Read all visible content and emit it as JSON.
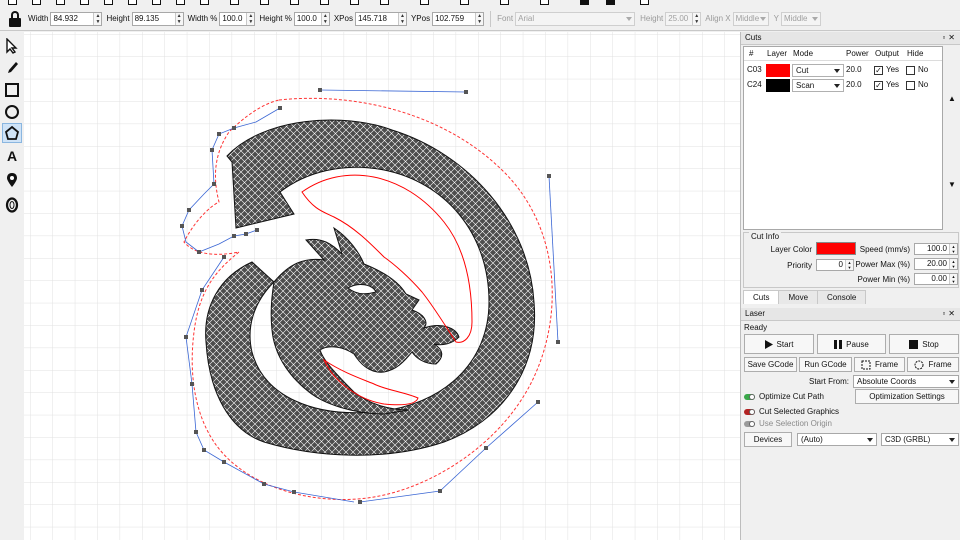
{
  "props": {
    "width_label": "Width",
    "width_value": "84.932",
    "height_label": "Height",
    "height_value": "89.135",
    "width_pct_label": "Width %",
    "width_pct_value": "100.0",
    "height_pct_label": "Height %",
    "height_pct_value": "100.0",
    "xpos_label": "XPos",
    "xpos_value": "145.718",
    "ypos_label": "YPos",
    "ypos_value": "102.759",
    "font_label": "Font",
    "font_value": "Arial",
    "font_height_label": "Height",
    "font_height_value": "25.00",
    "align_x_label": "Align X",
    "align_x_value": "Middle",
    "align_y_label": "Y",
    "align_y_value": "Middle"
  },
  "tools": [
    "select-arrow-icon",
    "pencil-icon",
    "rectangle-icon",
    "ellipse-icon",
    "polygon-icon",
    "text-icon",
    "position-marker-icon",
    "offset-icon"
  ],
  "tool_text": "A",
  "cuts": {
    "title": "Cuts",
    "columns": {
      "num": "#",
      "layer": "Layer",
      "mode": "Mode",
      "power": "Power",
      "output": "Output",
      "hide": "Hide"
    },
    "rows": [
      {
        "id": "C03",
        "color": "#ff0000",
        "mode": "Cut",
        "power": "20.0",
        "output": "Yes",
        "hide": "No"
      },
      {
        "id": "C24",
        "color": "#000000",
        "mode": "Scan",
        "power": "20.0",
        "output": "Yes",
        "hide": "No"
      }
    ]
  },
  "cut_info": {
    "title": "Cut Info",
    "layer_color_label": "Layer Color",
    "layer_color": "#ff0000",
    "priority_label": "Priority",
    "priority_value": "0",
    "speed_label": "Speed  (mm/s)",
    "speed_value": "100.0",
    "power_max_label": "Power Max (%)",
    "power_max_value": "20.00",
    "power_min_label": "Power Min (%)",
    "power_min_value": "0.00"
  },
  "tabs": [
    "Cuts",
    "Move",
    "Console"
  ],
  "laser": {
    "title": "Laser",
    "status": "Ready",
    "start": "Start",
    "pause": "Pause",
    "stop": "Stop",
    "save_gcode": "Save GCode",
    "run_gcode": "Run GCode",
    "frame1": "Frame",
    "frame2": "Frame",
    "start_from_label": "Start From:",
    "start_from_value": "Absolute Coords",
    "optimize_cut_path": "Optimize Cut Path",
    "optimization_settings": "Optimization Settings",
    "cut_selected_graphics": "Cut Selected Graphics",
    "use_selection_origin": "Use Selection Origin",
    "devices": "Devices",
    "device_port": "(Auto)",
    "device_type": "C3D (GRBL)"
  },
  "colors": {
    "accent_green": "#3aa84a",
    "accent_red": "#b22222",
    "grid": "#e1e1e1",
    "selection": "#ff0000"
  }
}
